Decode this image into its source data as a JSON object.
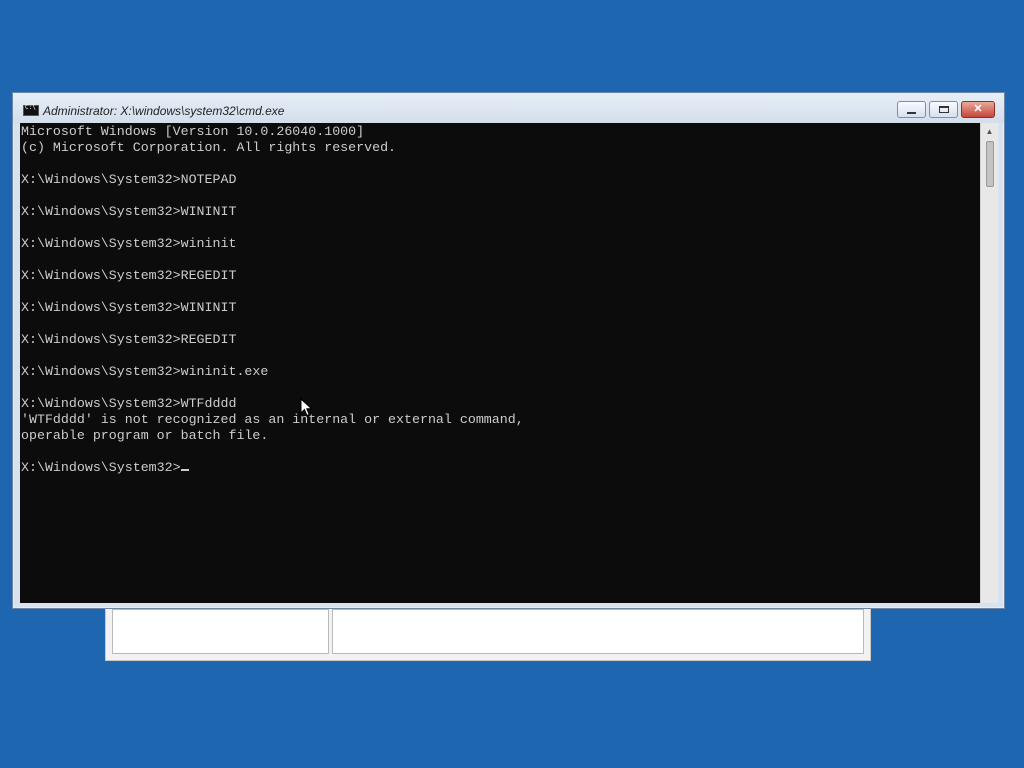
{
  "window": {
    "title": "Administrator: X:\\windows\\system32\\cmd.exe"
  },
  "console": {
    "lines": [
      "Microsoft Windows [Version 10.0.26040.1000]",
      "(c) Microsoft Corporation. All rights reserved.",
      "",
      "X:\\Windows\\System32>NOTEPAD",
      "",
      "X:\\Windows\\System32>WININIT",
      "",
      "X:\\Windows\\System32>wininit",
      "",
      "X:\\Windows\\System32>REGEDIT",
      "",
      "X:\\Windows\\System32>WININIT",
      "",
      "X:\\Windows\\System32>REGEDIT",
      "",
      "X:\\Windows\\System32>wininit.exe",
      "",
      "X:\\Windows\\System32>WTFdddd",
      "'WTFdddd' is not recognized as an internal or external command,",
      "operable program or batch file.",
      ""
    ],
    "prompt": "X:\\Windows\\System32>"
  },
  "colors": {
    "desktop": "#1f66b0",
    "console_bg": "#0c0c0c",
    "console_fg": "#cccccc"
  }
}
